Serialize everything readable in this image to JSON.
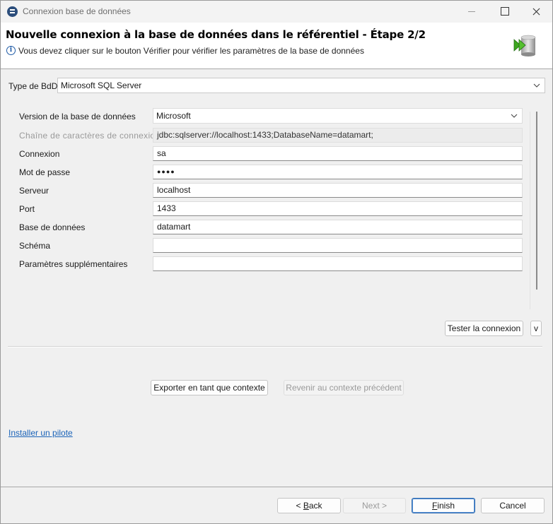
{
  "window": {
    "title": "Connexion base de données"
  },
  "header": {
    "title": "Nouvelle connexion à la base de données dans le référentiel - Étape 2/2",
    "message": "Vous devez cliquer sur le bouton Vérifier pour vérifier les paramètres de la base de données",
    "icons": [
      "info-icon",
      "database-arrow-icon"
    ]
  },
  "db_type": {
    "label": "Type de BdD",
    "value": "Microsoft SQL Server"
  },
  "form": {
    "version": {
      "label": "Version de la base de données",
      "value": "Microsoft"
    },
    "connection_string": {
      "label": "Chaîne de caractères de connexion",
      "value": "jdbc:sqlserver://localhost:1433;DatabaseName=datamart;"
    },
    "login": {
      "label": "Connexion",
      "value": "sa"
    },
    "password": {
      "label": "Mot de passe",
      "value": "●●●●"
    },
    "server": {
      "label": "Serveur",
      "value": "localhost"
    },
    "port": {
      "label": "Port",
      "value": "1433"
    },
    "database": {
      "label": "Base de données",
      "value": "datamart"
    },
    "schema": {
      "label": "Schéma",
      "value": ""
    },
    "extra_params": {
      "label": "Paramètres supplémentaires",
      "value": ""
    }
  },
  "buttons": {
    "test": "Tester la connexion",
    "v": "v",
    "export": "Exporter en tant que contexte",
    "revert": "Revenir au contexte précédent"
  },
  "install_driver_link": "Installer un pilote",
  "footer": {
    "back_prefix": "< ",
    "back_mnemonic": "B",
    "back_rest": "ack",
    "next": "Next >",
    "finish_mnemonic": "F",
    "finish_rest": "inish",
    "cancel": "Cancel"
  },
  "colors": {
    "link": "#1a63b8",
    "primary_border": "#2d6ab0",
    "db_icon_arrow": "#3da61f"
  }
}
